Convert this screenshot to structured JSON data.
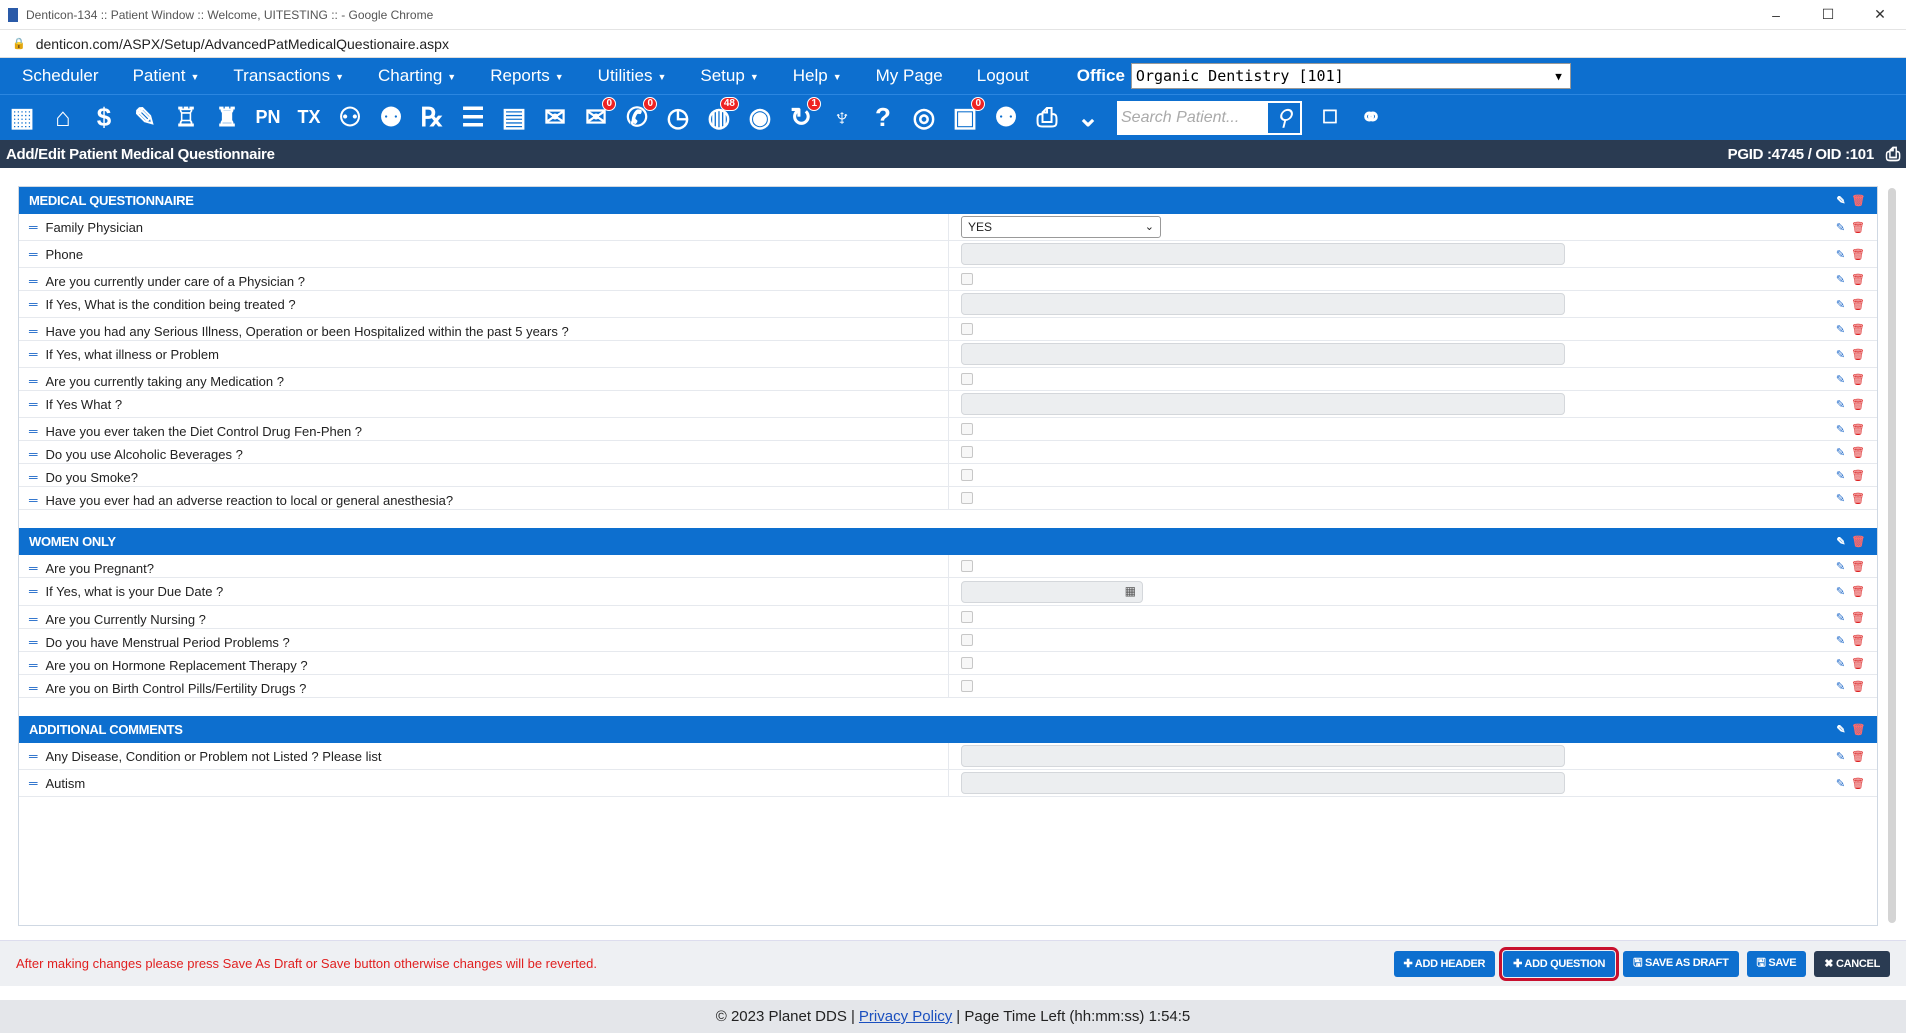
{
  "window": {
    "title": "Denticon-134 :: Patient Window :: Welcome, UITESTING :: - Google Chrome",
    "url": "denticon.com/ASPX/Setup/AdvancedPatMedicalQuestionaire.aspx",
    "controls": [
      "–",
      "☐",
      "✕"
    ]
  },
  "menu": {
    "items": [
      {
        "label": "Scheduler",
        "caret": false
      },
      {
        "label": "Patient",
        "caret": true
      },
      {
        "label": "Transactions",
        "caret": true
      },
      {
        "label": "Charting",
        "caret": true
      },
      {
        "label": "Reports",
        "caret": true
      },
      {
        "label": "Utilities",
        "caret": true
      },
      {
        "label": "Setup",
        "caret": true
      },
      {
        "label": "Help",
        "caret": true
      },
      {
        "label": "My Page",
        "caret": false
      },
      {
        "label": "Logout",
        "caret": false
      }
    ],
    "office_label": "Office",
    "office_value": "Organic Dentistry [101]"
  },
  "toolbar": {
    "icons": [
      {
        "name": "calendar-icon",
        "glyph": "▦"
      },
      {
        "name": "home-icon",
        "glyph": "⌂"
      },
      {
        "name": "dollar-icon",
        "glyph": "$"
      },
      {
        "name": "edit-chart-icon",
        "glyph": "✎"
      },
      {
        "name": "tooth-chart-icon",
        "glyph": "♖"
      },
      {
        "name": "perio-icon",
        "glyph": "♜"
      },
      {
        "name": "progress-notes-icon",
        "glyph": "PN"
      },
      {
        "name": "treatment-icon",
        "glyph": "TX"
      },
      {
        "name": "add-patient-icon",
        "glyph": "⚇"
      },
      {
        "name": "family-icon",
        "glyph": "⚉"
      },
      {
        "name": "prescription-icon",
        "glyph": "℞"
      },
      {
        "name": "notes-icon",
        "glyph": "☰"
      },
      {
        "name": "documents-icon",
        "glyph": "▤"
      },
      {
        "name": "mail-icon",
        "glyph": "✉"
      },
      {
        "name": "messages-icon",
        "glyph": "✉",
        "badge": "0"
      },
      {
        "name": "sms-icon",
        "glyph": "✆",
        "badge": "0"
      },
      {
        "name": "clock-icon",
        "glyph": "◷"
      },
      {
        "name": "web-icon",
        "glyph": "◍",
        "badge": "48"
      },
      {
        "name": "insurance-icon",
        "glyph": "◉"
      },
      {
        "name": "alerts-icon",
        "glyph": "↻",
        "badge": "1"
      },
      {
        "name": "tooth-icon",
        "glyph": "♆"
      },
      {
        "name": "help-icon",
        "glyph": "?"
      },
      {
        "name": "globe-icon",
        "glyph": "◎"
      },
      {
        "name": "tasks-icon",
        "glyph": "▣",
        "badge": "0"
      },
      {
        "name": "group-icon",
        "glyph": "⚉"
      },
      {
        "name": "print-icon",
        "glyph": "⎙"
      },
      {
        "name": "collapse-icon",
        "glyph": "⌄"
      }
    ],
    "search_placeholder": "Search Patient...",
    "trailing_icons": [
      "checkbox-icon",
      "advanced-search-icon"
    ]
  },
  "pagebar": {
    "title": "Add/Edit Patient Medical Questionnaire",
    "ids": "PGID :4745  /  OID :101"
  },
  "sections": [
    {
      "header": "MEDICAL QUESTIONNAIRE",
      "questions": [
        {
          "text": "Family Physician",
          "type": "select",
          "value": "YES"
        },
        {
          "text": "Phone",
          "type": "text"
        },
        {
          "text": "Are you currently under care of a Physician ?",
          "type": "checkbox"
        },
        {
          "text": "If Yes, What is the condition being treated ?",
          "type": "text"
        },
        {
          "text": "Have you had any Serious Illness, Operation or been Hospitalized within the past 5 years ?",
          "type": "checkbox"
        },
        {
          "text": "If Yes, what illness or Problem",
          "type": "text"
        },
        {
          "text": "Are you currently taking any Medication ?",
          "type": "checkbox"
        },
        {
          "text": "If Yes What ?",
          "type": "text"
        },
        {
          "text": "Have you ever taken the Diet Control Drug Fen-Phen ?",
          "type": "checkbox"
        },
        {
          "text": "Do you use Alcoholic Beverages ?",
          "type": "checkbox"
        },
        {
          "text": "Do you Smoke?",
          "type": "checkbox"
        },
        {
          "text": "Have you ever had an adverse reaction to local or general anesthesia?",
          "type": "checkbox"
        }
      ]
    },
    {
      "header": "WOMEN ONLY",
      "questions": [
        {
          "text": "Are you Pregnant?",
          "type": "checkbox"
        },
        {
          "text": "If Yes, what is your Due Date ?",
          "type": "date"
        },
        {
          "text": "Are you Currently Nursing ?",
          "type": "checkbox"
        },
        {
          "text": "Do you have Menstrual Period Problems ?",
          "type": "checkbox"
        },
        {
          "text": "Are you on Hormone Replacement Therapy ?",
          "type": "checkbox"
        },
        {
          "text": "Are you on Birth Control Pills/Fertility Drugs ?",
          "type": "checkbox"
        }
      ]
    },
    {
      "header": "ADDITIONAL COMMENTS",
      "questions": [
        {
          "text": "Any Disease, Condition or Problem not Listed ? Please list",
          "type": "text"
        },
        {
          "text": "Autism",
          "type": "text"
        }
      ]
    }
  ],
  "actions": {
    "warning": "After making changes please press Save As Draft or Save button otherwise changes will be reverted.",
    "add_header": "✚ ADD HEADER",
    "add_question": "✚ ADD QUESTION",
    "save_draft": "🖫 SAVE AS DRAFT",
    "save": "🖫 SAVE",
    "cancel": "✖ CANCEL"
  },
  "footer": {
    "copyright": "© 2023 Planet DDS |",
    "privacy": "Privacy Policy",
    "time_left": "|  Page Time Left (hh:mm:ss) 1:54:5"
  },
  "colors": {
    "brand_blue": "#0d6fcf",
    "dark_navy": "#2a3b52",
    "warning_red": "#e02020",
    "highlight_red": "#c8102e"
  }
}
